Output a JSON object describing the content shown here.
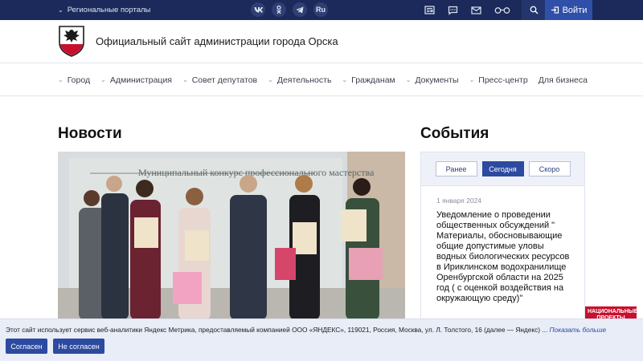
{
  "topbar": {
    "regional_label": "Региональные порталы",
    "social": [
      "VK",
      "OK",
      "TG",
      "Ru"
    ],
    "login_label": "Войти"
  },
  "header": {
    "site_title": "Официальный сайт администрации города Орска"
  },
  "nav": {
    "items": [
      "Город",
      "Администрация",
      "Совет депутатов",
      "Деятельность",
      "Гражданам",
      "Документы",
      "Пресс-центр",
      "Для бизнеса"
    ]
  },
  "news": {
    "title": "Новости",
    "photo_banner_text": "Муниципальный конкурс профессионального мастерства"
  },
  "events": {
    "title": "События",
    "tabs": [
      "Ранее",
      "Сегодня",
      "Скоро"
    ],
    "active_tab": "Сегодня",
    "date": "1 января 2024",
    "text": "Уведомление о проведении общественных обсуждений \" Материалы, обосновывающие общие допустимые уловы водных биологических ресурсов в Ириклинском водохранилище Оренбургской области на 2025 год ( с оценкой воздействия на окружающую среду)\""
  },
  "badge": {
    "line1": "НАЦИОНАЛЬНЫЕ",
    "line2": "ПРОЕКТЫ"
  },
  "cookie": {
    "message": "Этот сайт использует сервис веб-аналитики Яндекс Метрика, предоставляемый компанией ООО «ЯНДЕКС», 119021, Россия, Москва, ул. Л. Толстого, 16 (далее — Яндекс) ...",
    "more_link": "Показать больше",
    "agree_label": "Согласен",
    "disagree_label": "Не согласен"
  },
  "colors": {
    "topbar": "#1b2a5a",
    "accent": "#2c4aa0",
    "badge": "#c8102e"
  }
}
